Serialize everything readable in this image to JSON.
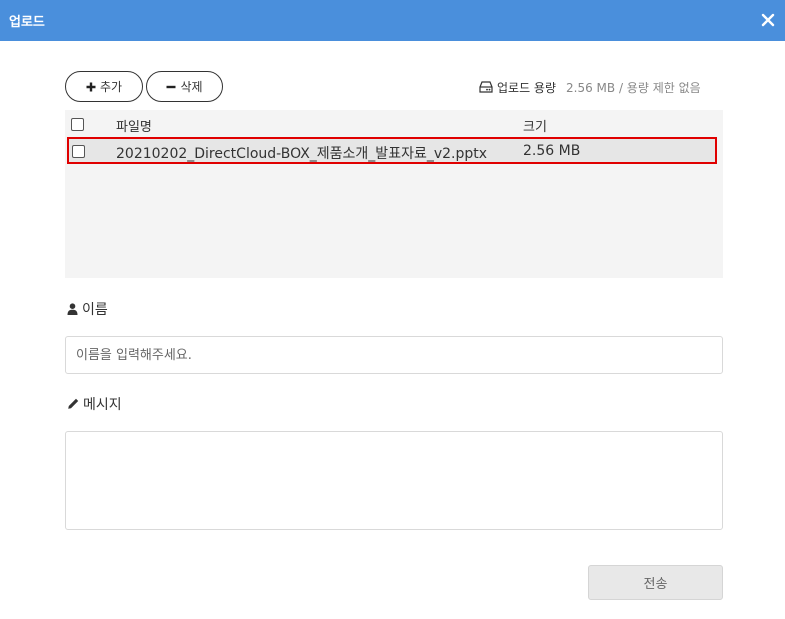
{
  "dialog": {
    "title": "업로드"
  },
  "toolbar": {
    "add_label": "추가",
    "delete_label": "삭제"
  },
  "capacity": {
    "label": "업로드 용량",
    "value": "2.56 MB / 용량 제한 없음"
  },
  "file_table": {
    "columns": [
      "파일명",
      "크기"
    ],
    "rows": [
      {
        "name": "20210202_DirectCloud-BOX_제품소개_발표자료_v2.pptx",
        "size": "2.56 MB",
        "checked": false,
        "highlighted": true
      }
    ]
  },
  "form": {
    "name_label": "이름",
    "name_placeholder": "이름을 입력해주세요.",
    "message_label": "메시지",
    "message_value": ""
  },
  "actions": {
    "send_label": "전송"
  },
  "colors": {
    "header_bg": "#4a8fdc",
    "highlight_border": "#e00000"
  }
}
